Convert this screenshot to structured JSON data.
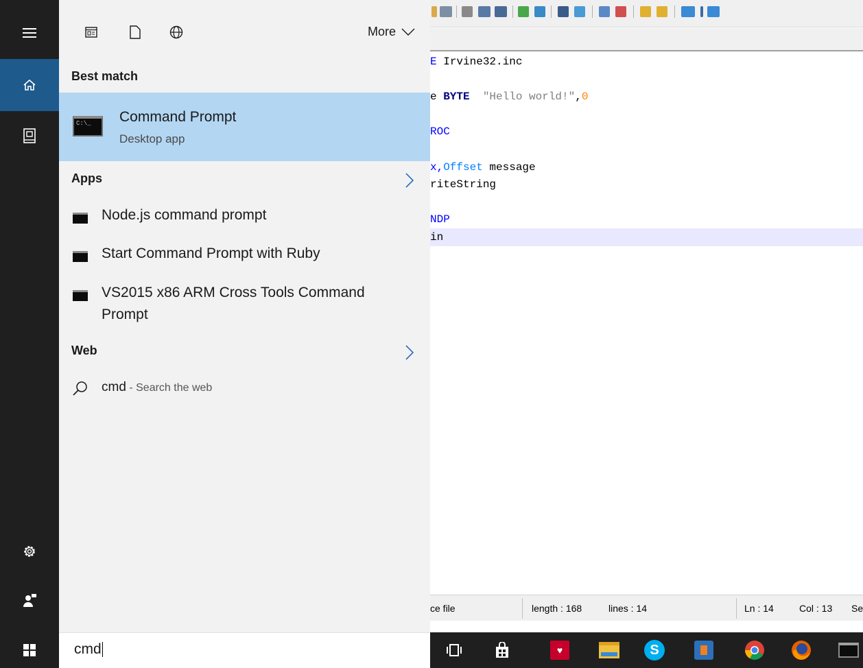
{
  "editor": {
    "code_lines": [
      {
        "parts": [
          {
            "t": "E",
            "c": "kw-blue"
          },
          {
            "t": " Irvine32.inc",
            "c": ""
          }
        ]
      },
      {
        "parts": []
      },
      {
        "parts": [
          {
            "t": "e ",
            "c": ""
          },
          {
            "t": "BYTE",
            "c": "kw-dblue"
          },
          {
            "t": "  ",
            "c": ""
          },
          {
            "t": "\"Hello world!\"",
            "c": "str"
          },
          {
            "t": ",",
            "c": ""
          },
          {
            "t": "0",
            "c": "num"
          }
        ]
      },
      {
        "parts": []
      },
      {
        "parts": [
          {
            "t": "ROC",
            "c": "kw-blue"
          }
        ]
      },
      {
        "parts": []
      },
      {
        "parts": [
          {
            "t": "x,",
            "c": "kw-blue"
          },
          {
            "t": "Offset",
            "c": "lightblue"
          },
          {
            "t": " message",
            "c": ""
          }
        ]
      },
      {
        "parts": [
          {
            "t": "riteString",
            "c": ""
          }
        ]
      },
      {
        "parts": []
      },
      {
        "parts": [
          {
            "t": "NDP",
            "c": "kw-blue"
          }
        ]
      },
      {
        "parts": [
          {
            "t": "in",
            "c": ""
          }
        ]
      }
    ],
    "status": {
      "file_type": "ce file",
      "length": "length : 168",
      "lines": "lines : 14",
      "ln": "Ln : 14",
      "col": "Col : 13",
      "sel": "Se"
    }
  },
  "rail": {
    "items": [
      {
        "name": "hamburger-menu-icon",
        "glyph": "≡"
      },
      {
        "name": "home-icon",
        "glyph": "⌂"
      },
      {
        "name": "notebook-icon",
        "glyph": "◘"
      },
      {
        "name": "settings-icon",
        "glyph": "⚙"
      },
      {
        "name": "feedback-icon",
        "glyph": "♟"
      }
    ]
  },
  "panel": {
    "more_label": "More",
    "best_match_heading": "Best match",
    "best_match": {
      "title": "Command Prompt",
      "subtitle": "Desktop app",
      "icon_text": "C:\\_"
    },
    "apps_heading": "Apps",
    "apps": [
      {
        "label": "Node.js command prompt"
      },
      {
        "label": "Start Command Prompt with Ruby"
      },
      {
        "label": "VS2015 x86 ARM Cross Tools Command Prompt"
      }
    ],
    "web_heading": "Web",
    "web": {
      "term": "cmd",
      "hint": " - Search the web"
    },
    "search_query": "cmd"
  },
  "colors": {
    "accent_selected": "#b3d6f2",
    "rail_bg": "#1f1f1f",
    "rail_active": "#1e5a8c",
    "panel_bg": "#f2f2f2"
  }
}
